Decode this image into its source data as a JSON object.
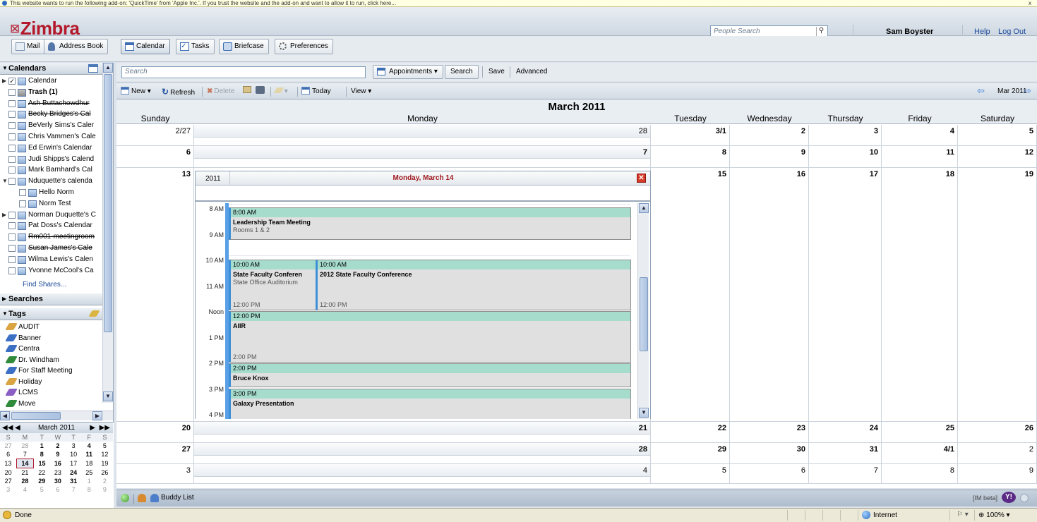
{
  "browser": {
    "infobar_text": "This website wants to run the following add-on: 'QuickTime' from 'Apple Inc.'. If you trust the website and the add-on and want to allow it to run, click here...",
    "status_text": "Done",
    "zone": "Internet",
    "zoom": "100%"
  },
  "header": {
    "logo": "Zimbra",
    "people_search_placeholder": "People Search",
    "user_name": "Sam Boyster",
    "help": "Help",
    "logout": "Log Out"
  },
  "apps": [
    {
      "label": "Mail",
      "icon": "mail-icon"
    },
    {
      "label": "Address Book",
      "icon": "address-book-icon"
    },
    {
      "label": "Calendar",
      "icon": "calendar-icon",
      "selected": true
    },
    {
      "label": "Tasks",
      "icon": "tasks-icon"
    },
    {
      "label": "Briefcase",
      "icon": "briefcase-icon"
    },
    {
      "label": "Preferences",
      "icon": "preferences-icon"
    }
  ],
  "sidebar": {
    "calendars_header": "Calendars",
    "calendars": [
      {
        "label": "Calendar",
        "checked": true,
        "level": 0,
        "expand": "▶"
      },
      {
        "label": "Trash (1)",
        "level": 0,
        "bold": true,
        "trash": true
      },
      {
        "label": "Ash Buttachowdhur",
        "level": 0,
        "strike": true
      },
      {
        "label": "Becky Bridges's Cal",
        "level": 0,
        "strike": true
      },
      {
        "label": "BeVerly Sims's Caler",
        "level": 0
      },
      {
        "label": "Chris Vammen's Cale",
        "level": 0
      },
      {
        "label": "Ed Erwin's Calendar",
        "level": 0
      },
      {
        "label": "Judi Shipps's Calend",
        "level": 0
      },
      {
        "label": "Mark Barnhard's Cal",
        "level": 0
      },
      {
        "label": "Nduquette's calenda",
        "level": 0,
        "expand": "▼"
      },
      {
        "label": "Hello Norm",
        "level": 1
      },
      {
        "label": "Norm Test",
        "level": 1
      },
      {
        "label": "Norman Duquette's C",
        "level": 0,
        "expand": "▶"
      },
      {
        "label": "Pat Doss's Calendar",
        "level": 0
      },
      {
        "label": "Rm001-meetingroom",
        "level": 0,
        "strike": true
      },
      {
        "label": "Susan James's Cale",
        "level": 0,
        "strike": true
      },
      {
        "label": "Wilma Lewis's Calen",
        "level": 0
      },
      {
        "label": "Yvonne McCool's Ca",
        "level": 0
      }
    ],
    "find_shares": "Find Shares...",
    "searches_header": "Searches",
    "tags_header": "Tags",
    "tags": [
      {
        "label": "AUDIT",
        "color": "#d9a441"
      },
      {
        "label": "Banner",
        "color": "#3b6fc4"
      },
      {
        "label": "Centra",
        "color": "#3b6fc4"
      },
      {
        "label": "Dr. Windham",
        "color": "#2f8a3a"
      },
      {
        "label": "For Staff Meeting",
        "color": "#3b6fc4"
      },
      {
        "label": "Holiday",
        "color": "#d9a441"
      },
      {
        "label": "LCMS",
        "color": "#8a5ec4"
      },
      {
        "label": "Move",
        "color": "#2f8a3a"
      }
    ]
  },
  "mini_calendar": {
    "title": "March 2011",
    "dow": [
      "S",
      "M",
      "T",
      "W",
      "T",
      "F",
      "S"
    ],
    "weeks": [
      [
        [
          "27",
          "o"
        ],
        [
          "28",
          "o"
        ],
        [
          "1",
          "b"
        ],
        [
          "2",
          "b"
        ],
        [
          "3",
          ""
        ],
        [
          "4",
          "b"
        ],
        [
          "5",
          ""
        ]
      ],
      [
        [
          "6",
          ""
        ],
        [
          "7",
          ""
        ],
        [
          "8",
          "b"
        ],
        [
          "9",
          "b"
        ],
        [
          "10",
          ""
        ],
        [
          "11",
          "b"
        ],
        [
          "12",
          ""
        ]
      ],
      [
        [
          "13",
          ""
        ],
        [
          "14",
          "t"
        ],
        [
          "15",
          "b"
        ],
        [
          "16",
          "b"
        ],
        [
          "17",
          ""
        ],
        [
          "18",
          ""
        ],
        [
          "19",
          ""
        ]
      ],
      [
        [
          "20",
          ""
        ],
        [
          "21",
          ""
        ],
        [
          "22",
          ""
        ],
        [
          "23",
          ""
        ],
        [
          "24",
          "b"
        ],
        [
          "25",
          ""
        ],
        [
          "26",
          ""
        ]
      ],
      [
        [
          "27",
          ""
        ],
        [
          "28",
          "b"
        ],
        [
          "29",
          "b"
        ],
        [
          "30",
          "b"
        ],
        [
          "31",
          "b"
        ],
        [
          "1",
          "o"
        ],
        [
          "2",
          "o"
        ]
      ],
      [
        [
          "3",
          "o"
        ],
        [
          "4",
          "o"
        ],
        [
          "5",
          "o"
        ],
        [
          "6",
          "o"
        ],
        [
          "7",
          "o"
        ],
        [
          "8",
          "o"
        ],
        [
          "9",
          "o"
        ]
      ]
    ]
  },
  "search": {
    "placeholder": "Search",
    "type": "Appointments",
    "search_btn": "Search",
    "save": "Save",
    "advanced": "Advanced"
  },
  "toolbar": {
    "new": "New",
    "refresh": "Refresh",
    "delete": "Delete",
    "today": "Today",
    "view": "View",
    "month_nav": "Mar 2011"
  },
  "month": {
    "title": "March 2011",
    "days": [
      "Sunday",
      "Monday",
      "Tuesday",
      "Wednesday",
      "Thursday",
      "Friday",
      "Saturday"
    ],
    "weeks": [
      [
        "2/27",
        "28",
        "3/1",
        "2",
        "3",
        "4",
        "5"
      ],
      [
        "6",
        "7",
        "8",
        "9",
        "10",
        "11",
        "12"
      ],
      [
        "13",
        "",
        "15",
        "16",
        "17",
        "18",
        "19"
      ],
      [
        "20",
        "21",
        "22",
        "23",
        "24",
        "25",
        "26"
      ],
      [
        "27",
        "28",
        "29",
        "30",
        "31",
        "4/1",
        "2"
      ],
      [
        "3",
        "4",
        "5",
        "6",
        "7",
        "8",
        "9"
      ]
    ]
  },
  "day_view": {
    "year": "2011",
    "title": "Monday, March 14",
    "hours": [
      "8 AM",
      "9 AM",
      "10 AM",
      "11 AM",
      "Noon",
      "1 PM",
      "2 PM",
      "3 PM",
      "4 PM"
    ],
    "appointments": [
      {
        "start": "8:00 AM",
        "title": "Leadership Team Meeting",
        "location": "Rooms 1 & 2",
        "end": ""
      },
      {
        "start": "10:00 AM",
        "title": "State Faculty Conferen",
        "location": "State Office Auditorium",
        "end": "12:00 PM"
      },
      {
        "start": "10:00 AM",
        "title": "2012 State Faculty Conference",
        "location": "",
        "end": "12:00 PM"
      },
      {
        "start": "12:00 PM",
        "title": "AIIR",
        "location": "",
        "end": "2:00 PM"
      },
      {
        "start": "2:00 PM",
        "title": "Bruce Knox",
        "location": "",
        "end": ""
      },
      {
        "start": "3:00 PM",
        "title": "Galaxy Presentation",
        "location": "",
        "end": ""
      }
    ]
  },
  "bottom": {
    "buddy_list": "Buddy List",
    "im": "[IM beta]"
  }
}
